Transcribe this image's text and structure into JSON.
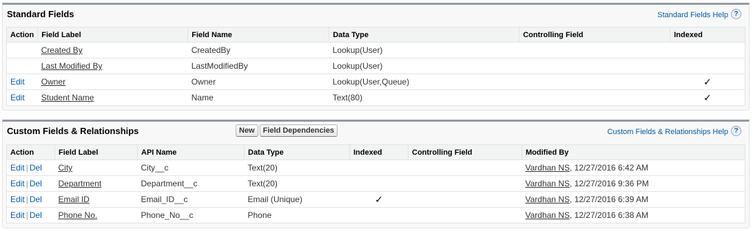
{
  "standard": {
    "title": "Standard Fields",
    "help_label": "Standard Fields Help",
    "help_icon": "?",
    "headers": [
      "Action",
      "Field Label",
      "Field Name",
      "Data Type",
      "Controlling Field",
      "Indexed"
    ],
    "rows": [
      {
        "action": "",
        "label": "Created By",
        "name": "CreatedBy",
        "type": "Lookup(User)",
        "controlling": "",
        "indexed": ""
      },
      {
        "action": "",
        "label": "Last Modified By",
        "name": "LastModifiedBy",
        "type": "Lookup(User)",
        "controlling": "",
        "indexed": ""
      },
      {
        "action": "Edit",
        "label": "Owner",
        "name": "Owner",
        "type": "Lookup(User,Queue)",
        "controlling": "",
        "indexed": "✓"
      },
      {
        "action": "Edit",
        "label": "Student Name",
        "name": "Name",
        "type": "Text(80)",
        "controlling": "",
        "indexed": "✓"
      }
    ]
  },
  "custom": {
    "title": "Custom Fields & Relationships",
    "new_button": "New",
    "deps_button": "Field Dependencies",
    "help_label": "Custom Fields & Relationships Help",
    "help_icon": "?",
    "headers": [
      "Action",
      "Field Label",
      "API Name",
      "Data Type",
      "Indexed",
      "Controlling Field",
      "Modified By"
    ],
    "rows": [
      {
        "edit": "Edit",
        "sep": "|",
        "del": "Del",
        "label": "City",
        "api": "City__c",
        "type": "Text(20)",
        "indexed": "",
        "controlling": "",
        "user": "Vardhan NS",
        "date": ", 12/27/2016 6:42 AM"
      },
      {
        "edit": "Edit",
        "sep": "|",
        "del": "Del",
        "label": "Department",
        "api": "Department__c",
        "type": "Text(20)",
        "indexed": "",
        "controlling": "",
        "user": "Vardhan NS",
        "date": ", 12/27/2016 9:36 PM"
      },
      {
        "edit": "Edit",
        "sep": "|",
        "del": "Del",
        "label": "Email ID",
        "api": "Email_ID__c",
        "type": "Email (Unique)",
        "indexed": "✓",
        "controlling": "",
        "user": "Vardhan NS",
        "date": ", 12/27/2016 6:39 AM"
      },
      {
        "edit": "Edit",
        "sep": "|",
        "del": "Del",
        "label": "Phone No.",
        "api": "Phone_No__c",
        "type": "Phone",
        "indexed": "",
        "controlling": "",
        "user": "Vardhan NS",
        "date": ", 12/27/2016 6:38 AM"
      }
    ]
  },
  "colors": {
    "link_blue": "#015ba7",
    "header_bar": "#939aa3",
    "panel_bg": "#f8f8f8"
  }
}
